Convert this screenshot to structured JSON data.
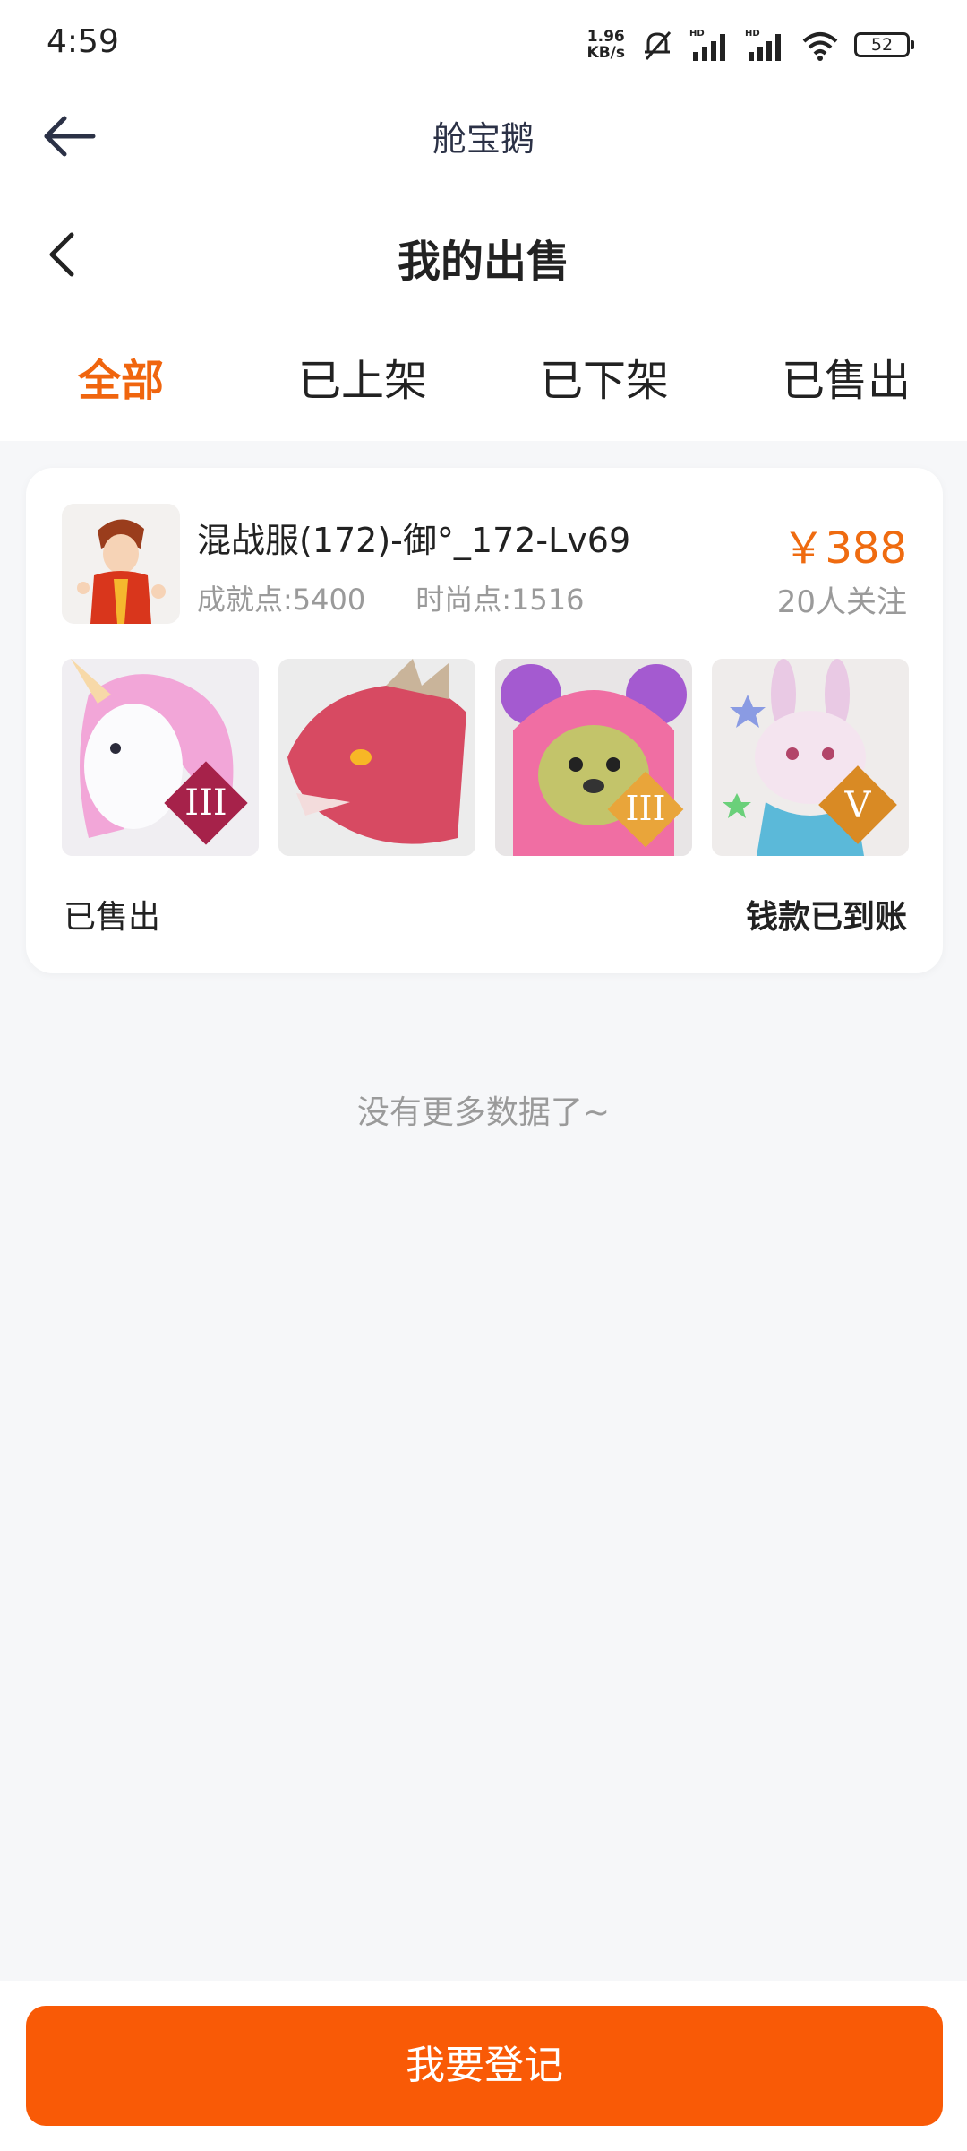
{
  "status_bar": {
    "time": "4:59",
    "net_speed_value": "1.96",
    "net_speed_unit": "KB/s",
    "signal_label": "HD",
    "battery": "52"
  },
  "app_header": {
    "title": "舱宝鹅"
  },
  "page": {
    "title": "我的出售"
  },
  "tabs": [
    {
      "label": "全部",
      "active": true
    },
    {
      "label": "已上架",
      "active": false
    },
    {
      "label": "已下架",
      "active": false
    },
    {
      "label": "已售出",
      "active": false
    }
  ],
  "listing": {
    "title": "混战服(172)-御°_172-Lv69",
    "achievement": "成就点:5400",
    "fashion": "时尚点:1516",
    "price": "￥388",
    "watchers": "20人关注",
    "thumbnails": [
      {
        "icon": "unicorn-mount-icon",
        "badge": "III"
      },
      {
        "icon": "dragon-mount-icon",
        "badge": ""
      },
      {
        "icon": "bear-pet-icon",
        "badge": "III"
      },
      {
        "icon": "rabbit-pet-icon",
        "badge": "V"
      }
    ],
    "status": "已售出",
    "payment_status": "钱款已到账"
  },
  "list_end_text": "没有更多数据了~",
  "bottom_button": "我要登记",
  "colors": {
    "accent": "#f95a06",
    "price": "#ef6b10",
    "background": "#f6f7f9"
  }
}
